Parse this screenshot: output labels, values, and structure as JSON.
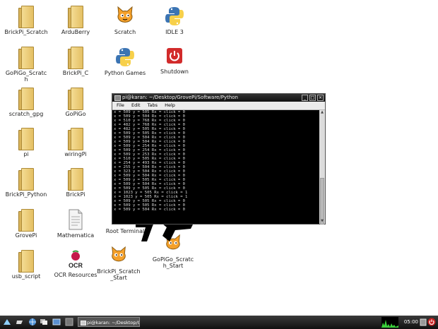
{
  "desktop": {
    "icons": [
      {
        "label": "BrickPi_Scratch",
        "type": "folder"
      },
      {
        "label": "ArduBerry",
        "type": "folder"
      },
      {
        "label": "Scratch",
        "type": "scratch-cat"
      },
      {
        "label": "IDLE 3",
        "type": "python"
      },
      {
        "label": "GoPiGo_Scratch",
        "type": "folder"
      },
      {
        "label": "BrickPi_C",
        "type": "folder"
      },
      {
        "label": "Python Games",
        "type": "python"
      },
      {
        "label": "Shutdown",
        "type": "power"
      },
      {
        "label": "scratch_gpg",
        "type": "folder"
      },
      {
        "label": "GoPiGo",
        "type": "folder"
      },
      {
        "label": "pi",
        "type": "folder"
      },
      {
        "label": "wiringPi",
        "type": "folder"
      },
      {
        "label": "BrickPi_Python",
        "type": "folder"
      },
      {
        "label": "BrickPi",
        "type": "folder"
      },
      {
        "label": "GrovePi",
        "type": "folder"
      },
      {
        "label": "Mathematica",
        "type": "document"
      },
      {
        "label": "Root Terminal",
        "type": "terminal"
      },
      {
        "label": "usb_script",
        "type": "folder"
      },
      {
        "label": "OCR Resources",
        "type": "ocr"
      },
      {
        "label": "BrickPi_Scratch_Start",
        "type": "scratch-cat"
      },
      {
        "label": "GoPiGo_Scratch_Start",
        "type": "scratch-cat"
      }
    ]
  },
  "terminal": {
    "title": "pi@karan: ~/Desktop/GrovePi/Software/Python",
    "menu": [
      "File",
      "Edit",
      "Tabs",
      "Help"
    ],
    "lines": [
      "x = 509  y = 505  Rx =  click = 0",
      "x = 509  y = 504  Rx =  click = 0",
      "x = 510  y = 768  Rx =  click = 0",
      "x = 482  y = 768  Rx =  click = 0",
      "x = 482  y = 505  Rx =  click = 0",
      "x = 509  y = 505  Rx =  click = 0",
      "x = 509  y = 504  Rx =  click = 0",
      "x = 509  y = 504  Rx =  click = 0",
      "x = 509  y = 254  Rx =  click = 0",
      "x = 509  y = 254  Rx =  click = 0",
      "x = 509  y = 253  Rx =  click = 0",
      "x = 510  y = 505  Rx =  click = 0",
      "x = 254  y = 493  Rx =  click = 0",
      "x = 255  y = 504  Rx =  click = 0",
      "x = 323  y = 504  Rx =  click = 0",
      "x = 509  y = 504  Rx =  click = 0",
      "x = 509  y = 505  Rx =  click = 0",
      "x = 509  y = 504  Rx =  click = 0",
      "x = 509  y = 505  Rx =  click = 0",
      "x = 1023  y = 505  Rx =  click = 1",
      "x = 1023  y = 505  Rx =  click = 1",
      "x = 509  y = 505  Rx =  click = 0",
      "x = 509  y = 505  Rx =  click = 0",
      "x = 509  y = 504  Rx =  click = 0"
    ]
  },
  "taskbar": {
    "task_label": "pi@karan: ~/Desktop/G...",
    "clock": "05:00"
  },
  "colors": {
    "folder": "#e4bf63",
    "taskbar": "#1e1e1e",
    "terminal_bg": "#000000"
  }
}
